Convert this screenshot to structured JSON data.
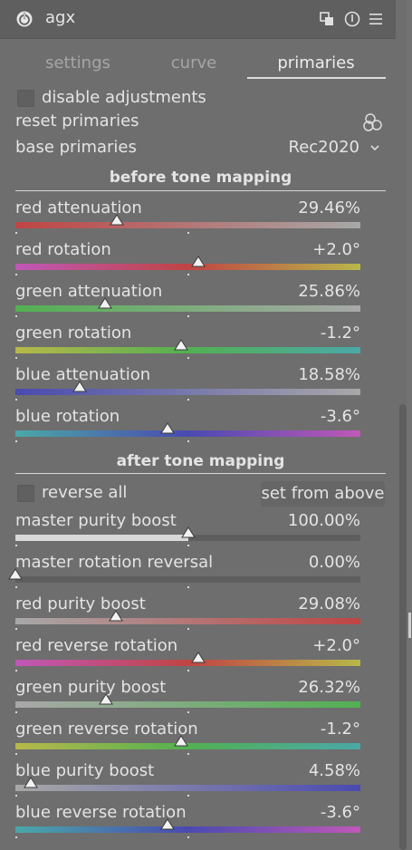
{
  "module": {
    "title": "agx"
  },
  "tabs": [
    {
      "label": "settings",
      "active": false
    },
    {
      "label": "curve",
      "active": false
    },
    {
      "label": "primaries",
      "active": true
    }
  ],
  "disable_adjustments": {
    "label": "disable adjustments",
    "checked": false
  },
  "reset_primaries": {
    "label": "reset primaries"
  },
  "base_primaries": {
    "label": "base primaries",
    "value": "Rec2020"
  },
  "before": {
    "title": "before tone mapping",
    "sliders": [
      {
        "label": "red attenuation",
        "value": "29.46%",
        "position": 0.2946
      },
      {
        "label": "red rotation",
        "value": "+2.0°",
        "position": 0.53
      },
      {
        "label": "green attenuation",
        "value": "25.86%",
        "position": 0.2586
      },
      {
        "label": "green rotation",
        "value": "-1.2°",
        "position": 0.48
      },
      {
        "label": "blue attenuation",
        "value": "18.58%",
        "position": 0.1858
      },
      {
        "label": "blue rotation",
        "value": "-3.6°",
        "position": 0.44
      }
    ]
  },
  "after": {
    "title": "after tone mapping",
    "reverse_all": {
      "label": "reverse all",
      "checked": false
    },
    "set_from_above": "set from above",
    "sliders": [
      {
        "label": "master purity boost",
        "value": "100.00%",
        "position": 0.5
      },
      {
        "label": "master rotation reversal",
        "value": "0.00%",
        "position": 0.0
      },
      {
        "label": "red purity boost",
        "value": "29.08%",
        "position": 0.2908
      },
      {
        "label": "red reverse rotation",
        "value": "+2.0°",
        "position": 0.53
      },
      {
        "label": "green purity boost",
        "value": "26.32%",
        "position": 0.2632
      },
      {
        "label": "green reverse rotation",
        "value": "-1.2°",
        "position": 0.48
      },
      {
        "label": "blue purity boost",
        "value": "4.58%",
        "position": 0.0458
      },
      {
        "label": "blue reverse rotation",
        "value": "-3.6°",
        "position": 0.44
      }
    ]
  },
  "colors": {
    "background": "#6e6e6e",
    "header": "#5f5f5f",
    "red": "#c04444",
    "green": "#52b052",
    "blue": "#4a4ab0",
    "yellow": "#b8b84a",
    "magenta": "#c058b8",
    "cyan": "#4aa8a8",
    "gray": "#a8a8a8"
  },
  "icons": [
    "power-icon",
    "multi-instance-icon",
    "reset-icon",
    "presets-icon",
    "color-picker-icon",
    "chevron-down-icon"
  ]
}
